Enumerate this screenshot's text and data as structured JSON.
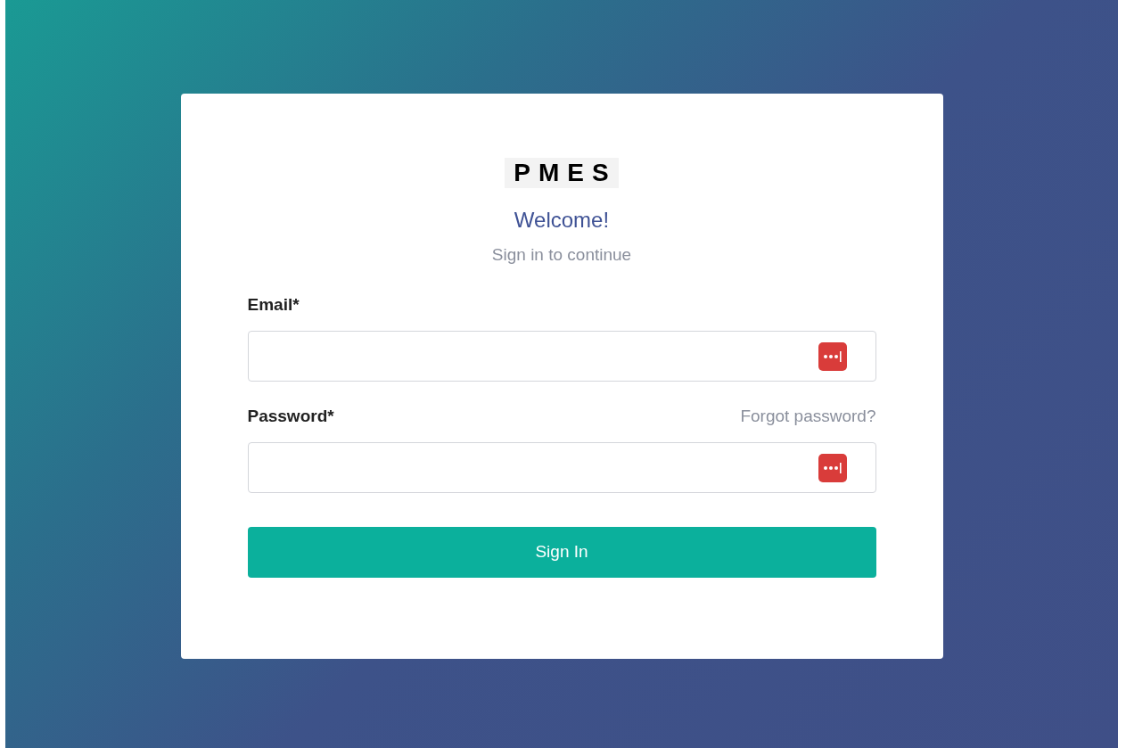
{
  "logo": "PMES",
  "heading": "Welcome!",
  "subtitle": "Sign in to continue",
  "fields": [
    {
      "label": "Email*"
    },
    {
      "label": "Password*",
      "link": "Forgot password?"
    }
  ],
  "button": "Sign In"
}
